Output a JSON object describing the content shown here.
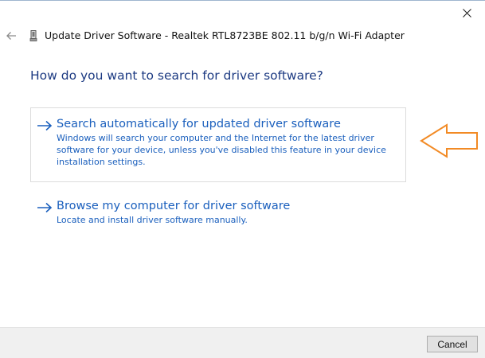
{
  "window": {
    "title": "Update Driver Software - Realtek RTL8723BE 802.11 b/g/n Wi-Fi Adapter",
    "close_icon": "close-icon",
    "back_icon": "back-arrow-icon"
  },
  "main": {
    "heading": "How do you want to search for driver software?",
    "options": [
      {
        "title": "Search automatically for updated driver software",
        "description": "Windows will search your computer and the Internet for the latest driver software for your device, unless you've disabled this feature in your device installation settings.",
        "icon": "right-arrow-icon",
        "selected": true
      },
      {
        "title": "Browse my computer for driver software",
        "description": "Locate and install driver software manually.",
        "icon": "right-arrow-icon",
        "selected": false
      }
    ]
  },
  "footer": {
    "cancel_label": "Cancel"
  },
  "colors": {
    "heading": "#1c3a82",
    "link": "#1a5fbd",
    "annotation": "#f28a24",
    "footer_bg": "#f0f0f0"
  }
}
